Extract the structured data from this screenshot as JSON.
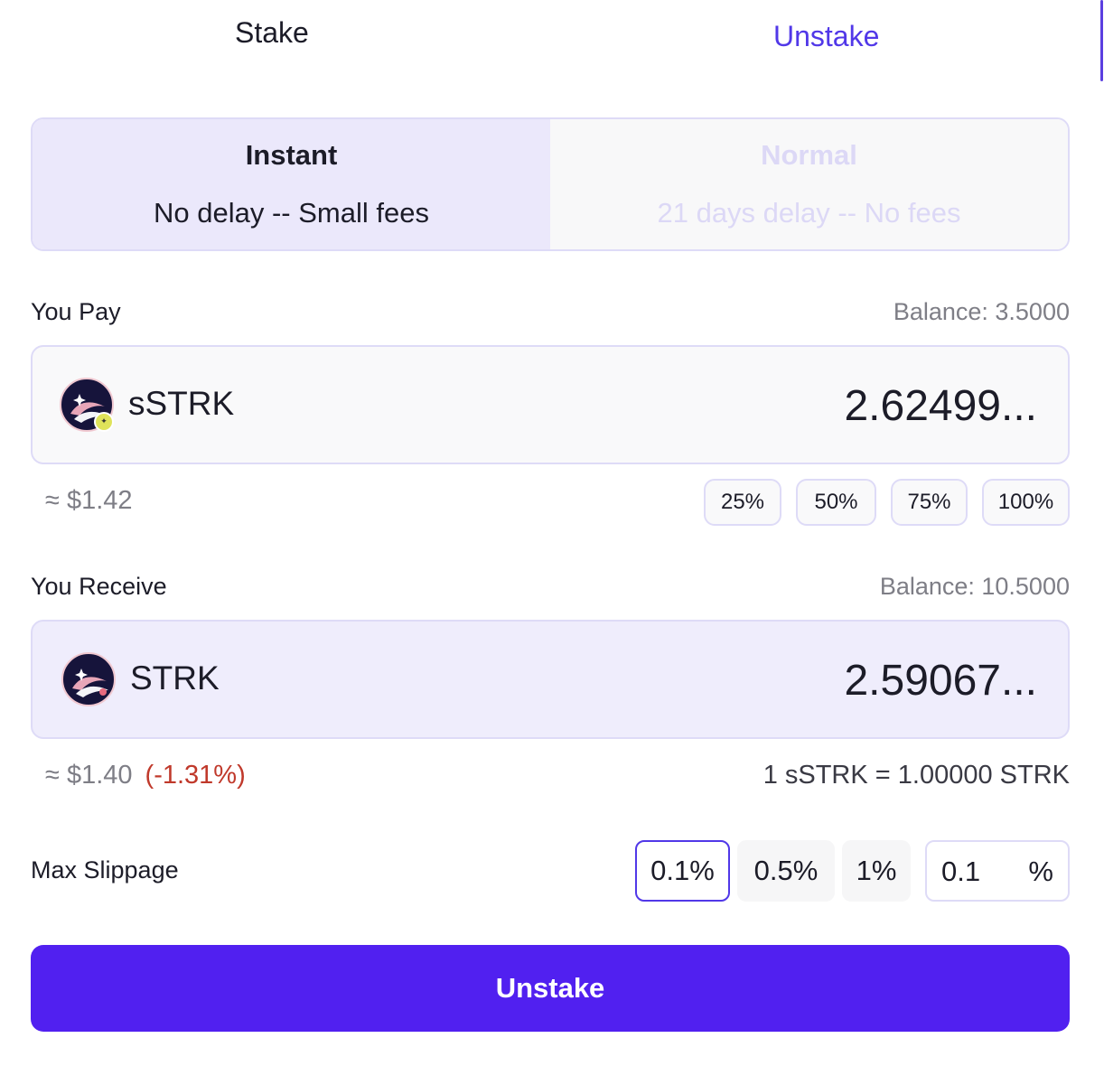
{
  "tabs": {
    "stake": "Stake",
    "unstake": "Unstake",
    "active": "Unstake"
  },
  "mode": {
    "instant": {
      "title": "Instant",
      "subtitle": "No delay -- Small fees"
    },
    "normal": {
      "title": "Normal",
      "subtitle": "21 days delay -- No fees"
    },
    "selected": "Instant"
  },
  "pay": {
    "label": "You Pay",
    "balance": "Balance: 3.5000",
    "token": "sSTRK",
    "token_icon": "starknet-logo-icon",
    "amount": "2.62499...",
    "usd": "≈ $1.42",
    "percent_buttons": [
      "25%",
      "50%",
      "75%",
      "100%"
    ]
  },
  "receive": {
    "label": "You Receive",
    "balance": "Balance: 10.5000",
    "token": "STRK",
    "token_icon": "starknet-logo-icon",
    "amount": "2.59067...",
    "usd": "≈ $1.40",
    "change": "(-1.31%)",
    "rate": "1 sSTRK = 1.00000 STRK"
  },
  "slippage": {
    "label": "Max Slippage",
    "options": [
      "0.1%",
      "0.5%",
      "1%"
    ],
    "selected": "0.1%",
    "custom_value": "0.1",
    "custom_unit": "%"
  },
  "cta": {
    "label": "Unstake"
  },
  "colors": {
    "accent": "#5120f0",
    "tab_active": "#5138e8",
    "negative": "#c0392b"
  }
}
